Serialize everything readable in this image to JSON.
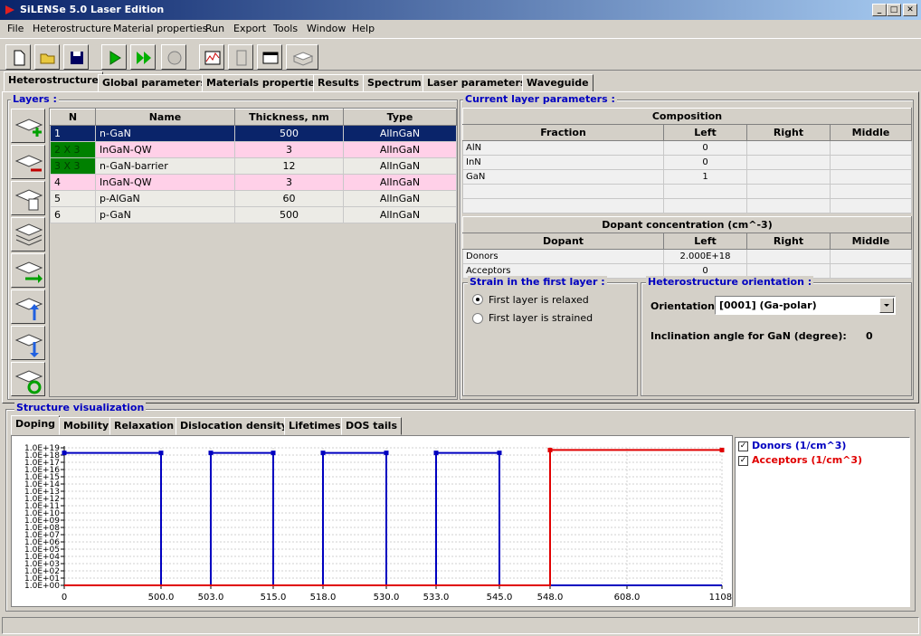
{
  "window": {
    "title": "SiLENSe 5.0 Laser Edition"
  },
  "menu": [
    "File",
    "Heterostructure",
    "Material properties",
    "Run",
    "Export",
    "Tools",
    "Window",
    "Help"
  ],
  "tabs": [
    "Heterostructure",
    "Global parameters",
    "Materials properties",
    "Results",
    "Spectrum",
    "Laser parameters",
    "Waveguide"
  ],
  "layers": {
    "title": "Layers :",
    "headers": [
      "N",
      "Name",
      "Thickness, nm",
      "Type"
    ],
    "rows": [
      {
        "n": "1",
        "name": "n-GaN",
        "thickness": "500",
        "type": "AlInGaN"
      },
      {
        "n": "2 X 3",
        "name": "InGaN-QW",
        "thickness": "3",
        "type": "AlInGaN"
      },
      {
        "n": "3 X 3",
        "name": "n-GaN-barrier",
        "thickness": "12",
        "type": "AlInGaN"
      },
      {
        "n": "4",
        "name": "InGaN-QW",
        "thickness": "3",
        "type": "AlInGaN"
      },
      {
        "n": "5",
        "name": "p-AlGaN",
        "thickness": "60",
        "type": "AlInGaN"
      },
      {
        "n": "6",
        "name": "p-GaN",
        "thickness": "500",
        "type": "AlInGaN"
      }
    ]
  },
  "current": {
    "title": "Current layer parameters :",
    "composition_title": "Composition",
    "comp_headers": [
      "Fraction",
      "Left",
      "Right",
      "Middle"
    ],
    "comp_rows": [
      [
        "AlN",
        "0",
        "",
        ""
      ],
      [
        "InN",
        "0",
        "",
        ""
      ],
      [
        "GaN",
        "1",
        "",
        ""
      ],
      [
        "",
        "",
        "",
        ""
      ],
      [
        "",
        "",
        "",
        ""
      ]
    ],
    "dopant_title": "Dopant concentration  (cm^-3)",
    "dop_headers": [
      "Dopant",
      "Left",
      "Right",
      "Middle"
    ],
    "dop_rows": [
      [
        "Donors",
        "2.000E+18",
        "",
        ""
      ],
      [
        "Acceptors",
        "0",
        "",
        ""
      ]
    ]
  },
  "strain": {
    "title": "Strain in the first layer :",
    "opt1": "First layer is relaxed",
    "opt2": "First layer is strained",
    "selected": 1
  },
  "orient": {
    "title": "Heterostructure orientation :",
    "label": "Orientation",
    "value": "[0001] (Ga-polar)",
    "incl_label": "Inclination angle for GaN (degree):",
    "incl_value": "0"
  },
  "viz": {
    "title": "Structure visualization",
    "tabs": [
      "Doping",
      "Mobility",
      "Relaxation",
      "Dislocation density",
      "Lifetimes",
      "DOS tails"
    ]
  },
  "legend": [
    {
      "label": "Donors (1/cm^3)",
      "color": "#0000c0"
    },
    {
      "label": "Acceptors (1/cm^3)",
      "color": "#e00000"
    }
  ],
  "chart_data": {
    "type": "line",
    "yscale": "log",
    "ylim": [
      1,
      1e+19
    ],
    "y_ticks": [
      "1.0E+00",
      "1.0E+01",
      "1.0E+02",
      "1.0E+03",
      "1.0E+04",
      "1.0E+05",
      "1.0E+06",
      "1.0E+07",
      "1.0E+08",
      "1.0E+09",
      "1.0E+10",
      "1.0E+11",
      "1.0E+12",
      "1.0E+13",
      "1.0E+14",
      "1.0E+15",
      "1.0E+16",
      "1.0E+17",
      "1.0E+18",
      "1.0E+19"
    ],
    "x_ticks": [
      "0",
      "500.0",
      "503.0",
      "515.0",
      "518.0",
      "530.0",
      "533.0",
      "545.0",
      "548.0",
      "608.0",
      "1108."
    ],
    "x_tick_values": [
      0,
      500,
      503,
      515,
      518,
      530,
      533,
      545,
      548,
      608,
      1108
    ],
    "series": [
      {
        "name": "Donors (1/cm^3)",
        "color": "#0000c0",
        "points": [
          [
            0,
            2e+18
          ],
          [
            500,
            2e+18
          ],
          [
            500,
            1
          ],
          [
            503,
            1
          ],
          [
            503,
            2e+18
          ],
          [
            515,
            2e+18
          ],
          [
            515,
            1
          ],
          [
            518,
            1
          ],
          [
            518,
            2e+18
          ],
          [
            530,
            2e+18
          ],
          [
            530,
            1
          ],
          [
            533,
            1
          ],
          [
            533,
            2e+18
          ],
          [
            545,
            2e+18
          ],
          [
            545,
            1
          ],
          [
            1108,
            1
          ]
        ]
      },
      {
        "name": "Acceptors (1/cm^3)",
        "color": "#e00000",
        "points": [
          [
            0,
            1
          ],
          [
            548,
            1
          ],
          [
            548,
            5e+18
          ],
          [
            1108,
            5e+18
          ]
        ]
      }
    ]
  }
}
